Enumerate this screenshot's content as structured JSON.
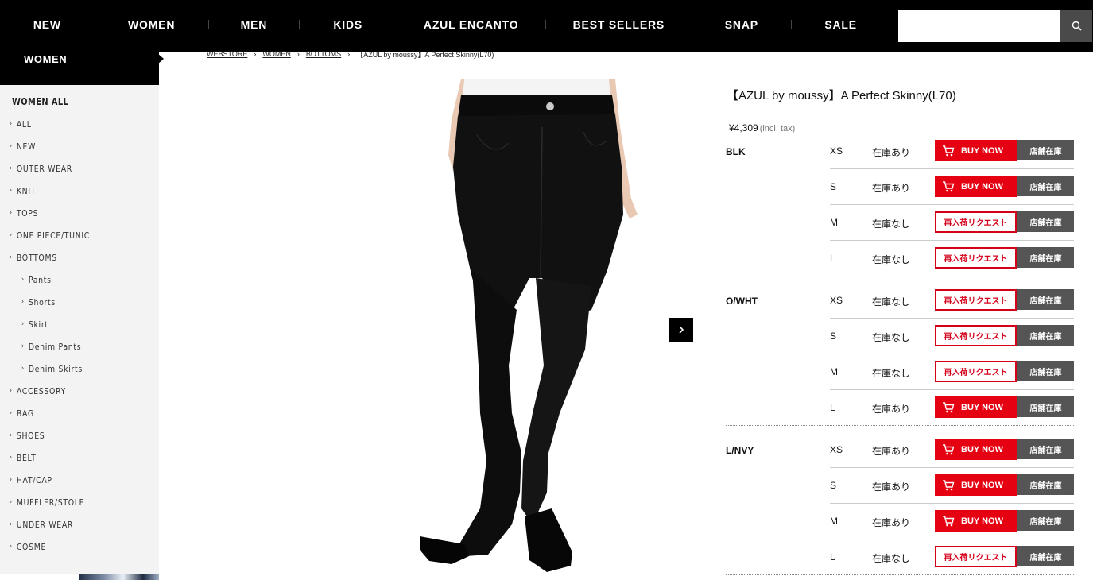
{
  "nav": {
    "items": [
      {
        "label": "NEW"
      },
      {
        "label": "WOMEN"
      },
      {
        "label": "MEN"
      },
      {
        "label": "KIDS"
      },
      {
        "label": "AZUL ENCANTO"
      },
      {
        "label": "BEST SELLERS"
      },
      {
        "label": "SNAP"
      },
      {
        "label": "SALE"
      }
    ],
    "search_value": ""
  },
  "sidebar": {
    "header": "WOMEN",
    "title": "WOMEN ALL",
    "items": [
      {
        "label": "ALL",
        "level": 1
      },
      {
        "label": "NEW",
        "level": 1
      },
      {
        "label": "OUTER WEAR",
        "level": 1
      },
      {
        "label": "KNIT",
        "level": 1
      },
      {
        "label": "TOPS",
        "level": 1
      },
      {
        "label": "ONE PIECE/TUNIC",
        "level": 1
      },
      {
        "label": "BOTTOMS",
        "level": 1
      },
      {
        "label": "Pants",
        "level": 2
      },
      {
        "label": "Shorts",
        "level": 2
      },
      {
        "label": "Skirt",
        "level": 2
      },
      {
        "label": "Denim Pants",
        "level": 2
      },
      {
        "label": "Denim Skirts",
        "level": 2
      },
      {
        "label": "ACCESSORY",
        "level": 1
      },
      {
        "label": "BAG",
        "level": 1
      },
      {
        "label": "SHOES",
        "level": 1
      },
      {
        "label": "BELT",
        "level": 1
      },
      {
        "label": "HAT/CAP",
        "level": 1
      },
      {
        "label": "MUFFLER/STOLE",
        "level": 1
      },
      {
        "label": "UNDER WEAR",
        "level": 1
      },
      {
        "label": "COSME",
        "level": 1
      }
    ]
  },
  "breadcrumb": {
    "items": [
      "WEBSTORE",
      "WOMEN",
      "BOTTOMS"
    ],
    "current": "【AZUL by moussy】A Perfect Skinny(L70)"
  },
  "product": {
    "name": "【AZUL by moussy】A Perfect Skinny(L70)",
    "price": "¥4,309",
    "tax_note": "(incl. tax)",
    "image_icon": "skinny-jeans-model-photo"
  },
  "labels": {
    "buy_now": "BUY NOW",
    "restock_request": "再入荷リクエスト",
    "store_stock": "店舗在庫"
  },
  "stock": [
    {
      "color": "BLK",
      "sizes": [
        {
          "size": "XS",
          "status": "在庫あり",
          "available": true
        },
        {
          "size": "S",
          "status": "在庫あり",
          "available": true
        },
        {
          "size": "M",
          "status": "在庫なし",
          "available": false
        },
        {
          "size": "L",
          "status": "在庫なし",
          "available": false
        }
      ]
    },
    {
      "color": "O/WHT",
      "sizes": [
        {
          "size": "XS",
          "status": "在庫なし",
          "available": false
        },
        {
          "size": "S",
          "status": "在庫なし",
          "available": false
        },
        {
          "size": "M",
          "status": "在庫なし",
          "available": false
        },
        {
          "size": "L",
          "status": "在庫あり",
          "available": true
        }
      ]
    },
    {
      "color": "L/NVY",
      "sizes": [
        {
          "size": "XS",
          "status": "在庫あり",
          "available": true
        },
        {
          "size": "S",
          "status": "在庫あり",
          "available": true
        },
        {
          "size": "M",
          "status": "在庫あり",
          "available": true
        },
        {
          "size": "L",
          "status": "在庫なし",
          "available": false
        }
      ]
    }
  ],
  "colors": {
    "nav_bg": "#000000",
    "buy_red": "#e50012",
    "request_red": "#d4001a",
    "store_gray": "#555555",
    "sidebar_bg": "#f3f3f3"
  }
}
